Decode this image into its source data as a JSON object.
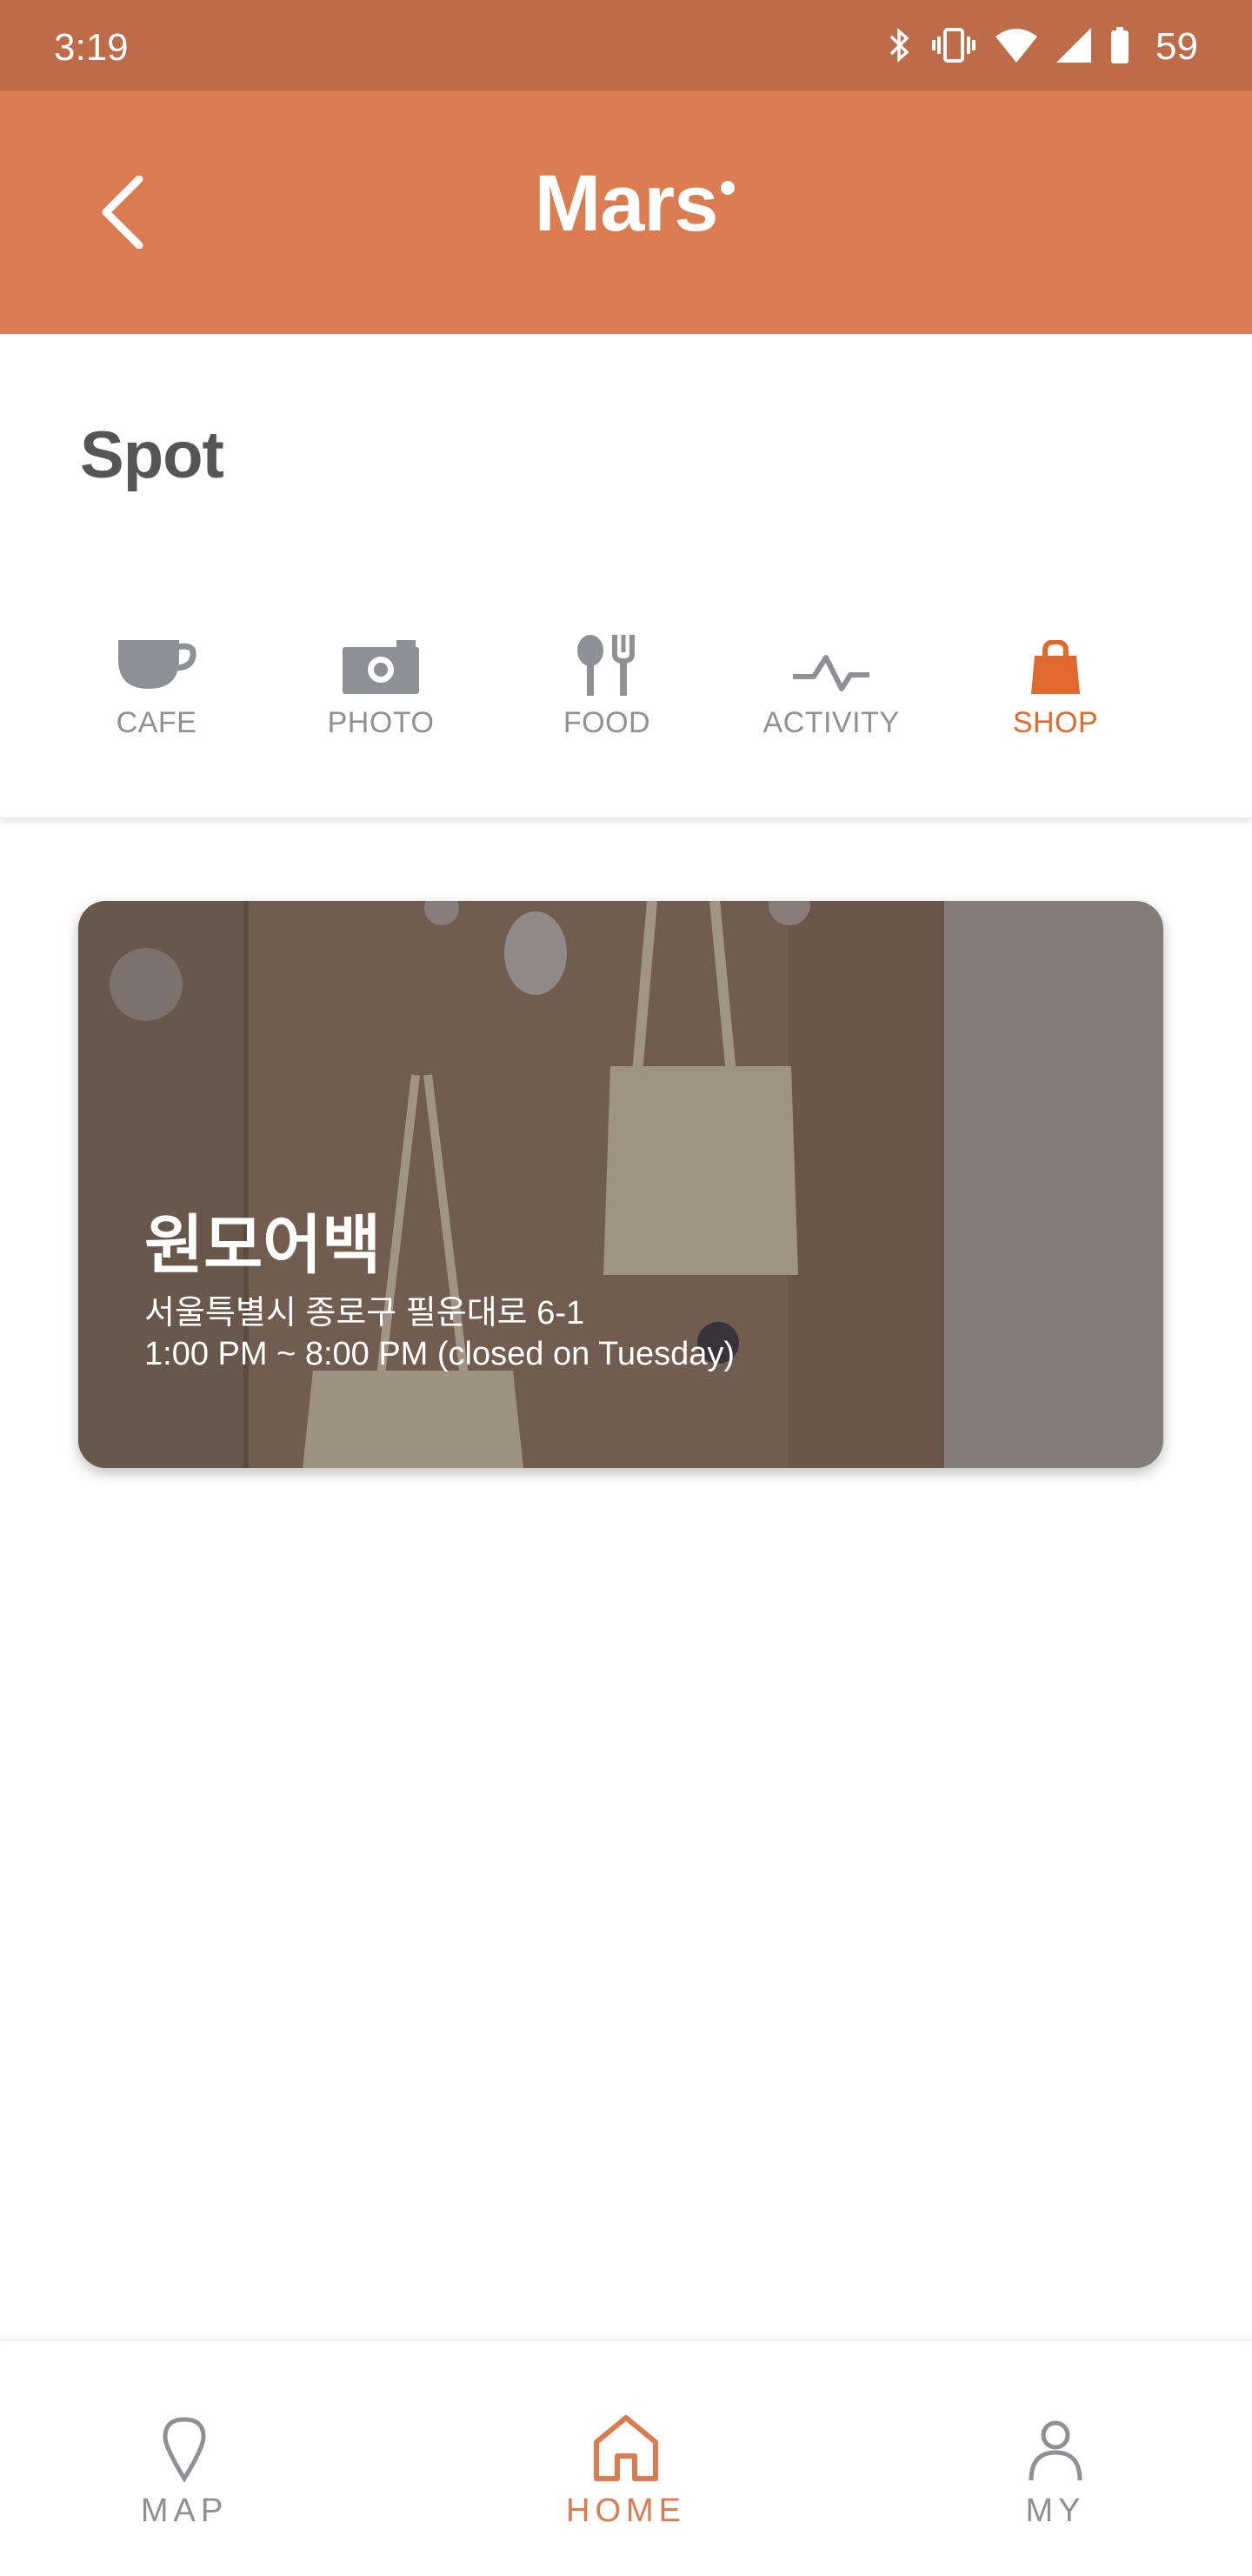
{
  "status_bar": {
    "time": "3:19",
    "battery": "59"
  },
  "app_bar": {
    "title": "Mars"
  },
  "spot": {
    "heading": "Spot",
    "categories": [
      {
        "label": "CAFE",
        "icon": "coffee-cup-icon",
        "active": false
      },
      {
        "label": "PHOTO",
        "icon": "camera-icon",
        "active": false
      },
      {
        "label": "FOOD",
        "icon": "utensils-icon",
        "active": false
      },
      {
        "label": "ACTIVITY",
        "icon": "activity-pulse-icon",
        "active": false
      },
      {
        "label": "SHOP",
        "icon": "shopping-bag-icon",
        "active": true
      }
    ]
  },
  "cards": [
    {
      "title": "원모어백",
      "address": "서울특별시 종로구 필운대로 6-1",
      "hours": "1:00 PM ~ 8:00 PM (closed on Tuesday)"
    }
  ],
  "bottom_nav": {
    "items": [
      {
        "label": "MAP",
        "icon": "map-pin-icon",
        "active": false
      },
      {
        "label": "HOME",
        "icon": "home-icon",
        "active": true
      },
      {
        "label": "MY",
        "icon": "person-icon",
        "active": false
      }
    ]
  },
  "colors": {
    "status_bar": "#be6b47",
    "app_bar": "#db7b51",
    "accent": "#e06a2e",
    "inactive": "#8f8f96"
  }
}
